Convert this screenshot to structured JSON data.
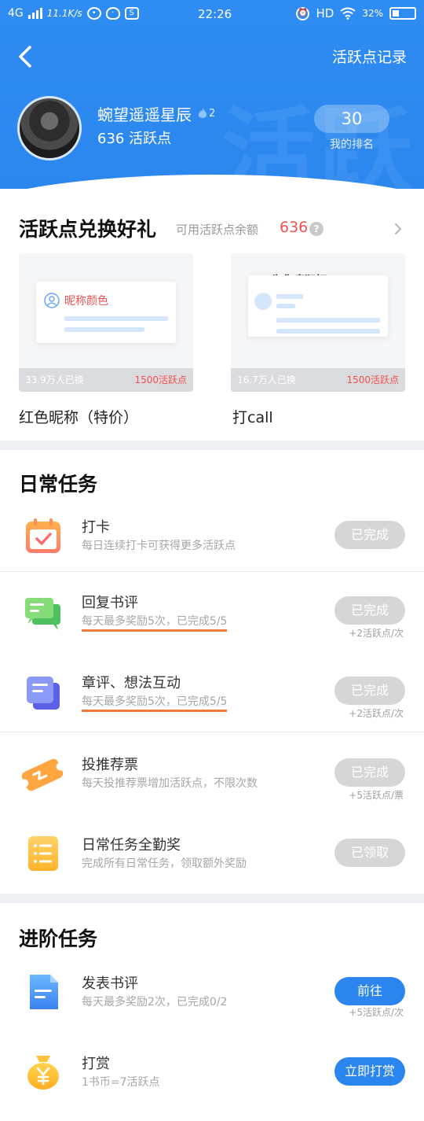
{
  "status_bar": {
    "network": "4G",
    "speed": "11.1K/s",
    "time": "22:26",
    "hd": "HD",
    "battery": "32%"
  },
  "header": {
    "record_link": "活跃点记录",
    "username": "蜿望遥遥星辰",
    "level": "2",
    "points_text": "636 活跃点",
    "rank_value": "30",
    "rank_label": "我的排名",
    "watermark": "活跃"
  },
  "exchange": {
    "title": "活跃点兑换好礼",
    "balance_label": "可用活跃点余额",
    "balance_value": "636",
    "gifts": [
      {
        "card_text": "昵称颜色",
        "redeemed": "33.9万人已换",
        "cost": "1500活跃点",
        "name": "红色昵称（特价）"
      },
      {
        "card_text": "为你疯狂打Call",
        "redeemed": "16.7万人已换",
        "cost": "1500活跃点",
        "name": "打call"
      }
    ]
  },
  "daily": {
    "title": "日常任务",
    "tasks": [
      {
        "title": "打卡",
        "desc": "每日连续打卡可获得更多活跃点",
        "button": "已完成",
        "reward": ""
      },
      {
        "title": "回复书评",
        "desc": "每天最多奖励5次，已完成5/5",
        "button": "已完成",
        "reward": "+2活跃点/次"
      },
      {
        "title": "章评、想法互动",
        "desc": "每天最多奖励5次，已完成5/5",
        "button": "已完成",
        "reward": "+2活跃点/次"
      },
      {
        "title": "投推荐票",
        "desc": "每天投推荐票增加活跃点，不限次数",
        "button": "已完成",
        "reward": "+5活跃点/票"
      },
      {
        "title": "日常任务全勤奖",
        "desc": "完成所有日常任务，领取额外奖励",
        "button": "已领取",
        "reward": ""
      }
    ]
  },
  "advanced": {
    "title": "进阶任务",
    "tasks": [
      {
        "title": "发表书评",
        "desc": "每天最多奖励2次，已完成0/2",
        "button": "前往",
        "reward": "+5活跃点/次"
      },
      {
        "title": "打赏",
        "desc": "1书币=7活跃点",
        "button": "立即打赏",
        "reward": ""
      }
    ]
  },
  "colors": {
    "brand_blue": "#2b87ee",
    "accent_red": "#f0524f",
    "underline_orange": "#f07a3a",
    "done_gray": "#d6d6d6"
  }
}
